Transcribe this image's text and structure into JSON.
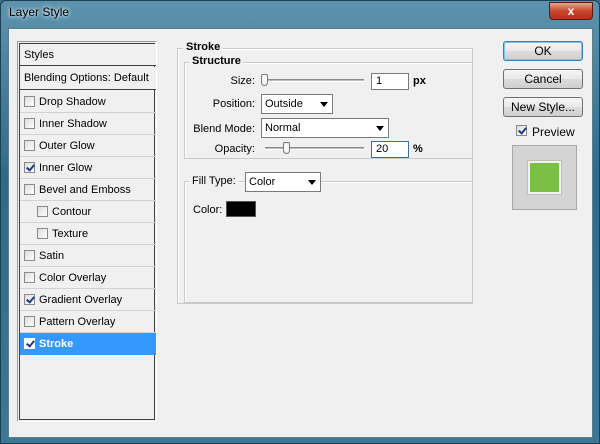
{
  "window": {
    "title": "Layer Style",
    "close_label": "x"
  },
  "styles_list": {
    "header": "Styles",
    "blending": "Blending Options: Default",
    "items": [
      {
        "label": "Drop Shadow",
        "checked": false,
        "indent": false,
        "selected": false
      },
      {
        "label": "Inner Shadow",
        "checked": false,
        "indent": false,
        "selected": false
      },
      {
        "label": "Outer Glow",
        "checked": false,
        "indent": false,
        "selected": false
      },
      {
        "label": "Inner Glow",
        "checked": true,
        "indent": false,
        "selected": false
      },
      {
        "label": "Bevel and Emboss",
        "checked": false,
        "indent": false,
        "selected": false
      },
      {
        "label": "Contour",
        "checked": false,
        "indent": true,
        "selected": false
      },
      {
        "label": "Texture",
        "checked": false,
        "indent": true,
        "selected": false
      },
      {
        "label": "Satin",
        "checked": false,
        "indent": false,
        "selected": false
      },
      {
        "label": "Color Overlay",
        "checked": false,
        "indent": false,
        "selected": false
      },
      {
        "label": "Gradient Overlay",
        "checked": true,
        "indent": false,
        "selected": false
      },
      {
        "label": "Pattern Overlay",
        "checked": false,
        "indent": false,
        "selected": false
      },
      {
        "label": "Stroke",
        "checked": true,
        "indent": false,
        "selected": true
      }
    ]
  },
  "stroke": {
    "title": "Stroke",
    "structure_title": "Structure",
    "size_label": "Size:",
    "size_value": "1",
    "size_unit": "px",
    "size_fraction": 0.0,
    "position_label": "Position:",
    "position_value": "Outside",
    "blend_label": "Blend Mode:",
    "blend_value": "Normal",
    "opacity_label": "Opacity:",
    "opacity_value": "20",
    "opacity_unit": "%",
    "opacity_fraction": 0.2
  },
  "fill": {
    "type_label": "Fill Type:",
    "type_value": "Color",
    "color_label": "Color:",
    "color_hex": "#000000"
  },
  "buttons": {
    "ok": "OK",
    "cancel": "Cancel",
    "new_style": "New Style...",
    "preview_label": "Preview",
    "preview_checked": true
  },
  "colors": {
    "selection": "#3399ff",
    "preview_swatch": "#7ac143"
  }
}
